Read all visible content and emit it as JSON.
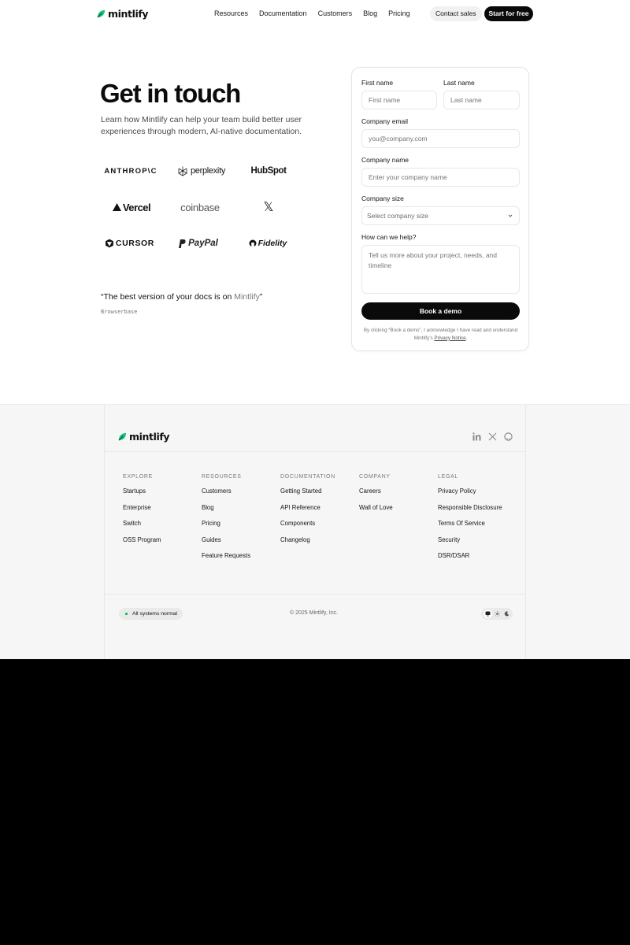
{
  "header": {
    "brand": "mintlify",
    "nav": [
      "Resources",
      "Documentation",
      "Customers",
      "Blog",
      "Pricing"
    ],
    "contact_label": "Contact sales",
    "start_label": "Start for free"
  },
  "hero": {
    "title": "Get in touch",
    "subtitle": "Learn how Mintlify can help your team build better user experiences through modern, AI-native documentation.",
    "logos": {
      "anthropic": "ANTHROP\\C",
      "perplexity": "perplexity",
      "hubspot": "HubSpot",
      "vercel": "Vercel",
      "coinbase": "coinbase",
      "x": "𝕏",
      "cursor": "CURSOR",
      "paypal": "PayPal",
      "fidelity": "Fidelity"
    },
    "quote_prefix": "“The best version of your docs is on ",
    "quote_highlight": "Mintlify",
    "quote_suffix": "”",
    "quote_author": "Browserbase"
  },
  "form": {
    "first_name": {
      "label": "First name",
      "placeholder": "First name"
    },
    "last_name": {
      "label": "Last name",
      "placeholder": "Last name"
    },
    "email": {
      "label": "Company email",
      "placeholder": "you@company.com"
    },
    "company": {
      "label": "Company name",
      "placeholder": "Enter your company name"
    },
    "size": {
      "label": "Company size",
      "placeholder": "Select company size"
    },
    "help": {
      "label": "How can we help?",
      "placeholder": "Tell us more about your project, needs, and timeline"
    },
    "submit_label": "Book a demo",
    "legal_text": "By clicking “Book a demo”, I acknowledge I have read and understand Mintlify’s ",
    "legal_link": "Privacy Notice",
    "legal_end": "."
  },
  "footer": {
    "brand": "mintlify",
    "social": [
      "linkedin-icon",
      "x-icon",
      "github-icon"
    ],
    "columns": [
      {
        "title": "EXPLORE",
        "items": [
          "Startups",
          "Enterprise",
          "Switch",
          "OSS Program"
        ]
      },
      {
        "title": "RESOURCES",
        "items": [
          "Customers",
          "Blog",
          "Pricing",
          "Guides",
          "Feature Requests"
        ]
      },
      {
        "title": "DOCUMENTATION",
        "items": [
          "Getting Started",
          "API Reference",
          "Components",
          "Changelog"
        ]
      },
      {
        "title": "COMPANY",
        "items": [
          "Careers",
          "Wall of Love"
        ]
      },
      {
        "title": "LEGAL",
        "items": [
          "Privacy Policy",
          "Responsible Disclosure",
          "Terms Of Service",
          "Security",
          "DSR/DSAR"
        ]
      }
    ],
    "status": "All systems normal",
    "copyright": "© 2025 Mintlify, Inc.",
    "theme_options": [
      "system-icon",
      "sun-icon",
      "moon-icon"
    ]
  },
  "colors": {
    "brand_green": "#18c37d",
    "brand_dark_green": "#0c8c5e",
    "button_black": "#0a0a0a",
    "footer_bg": "#f6f6f6",
    "status_green": "#16a34a"
  }
}
